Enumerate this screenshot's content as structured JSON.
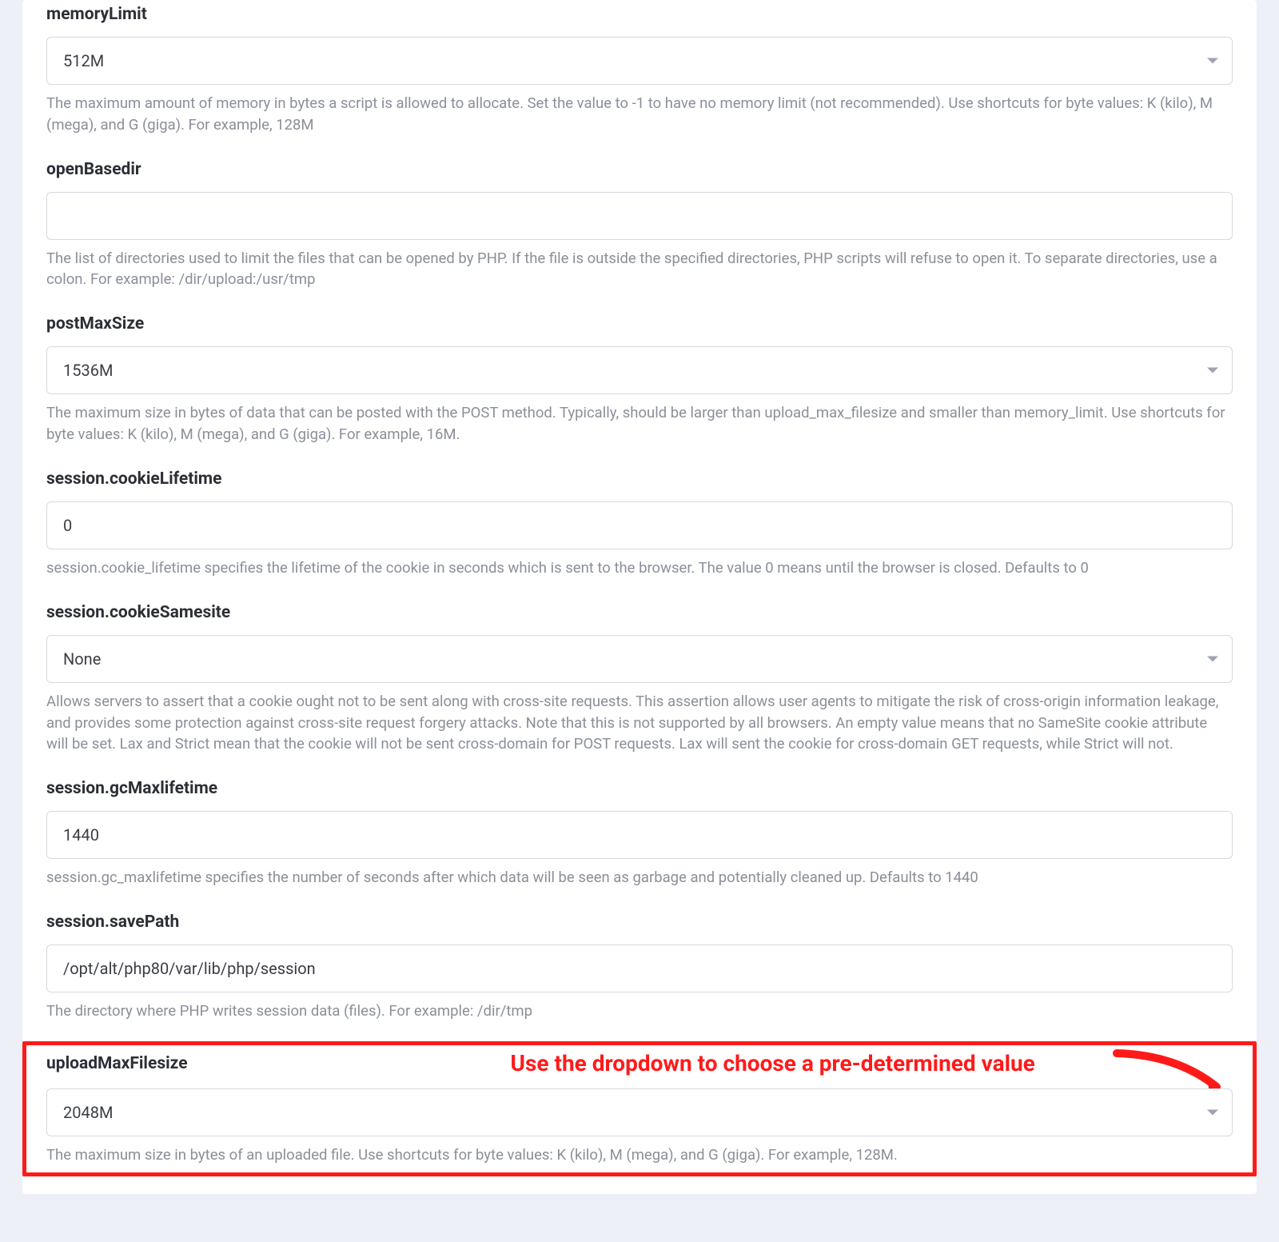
{
  "fields": {
    "memoryLimit": {
      "label": "memoryLimit",
      "value": "512M",
      "help": "The maximum amount of memory in bytes a script is allowed to allocate. Set the value to -1 to have no memory limit (not recommended). Use shortcuts for byte values: K (kilo), M (mega), and G (giga). For example, 128M"
    },
    "openBasedir": {
      "label": "openBasedir",
      "value": "",
      "help": "The list of directories used to limit the files that can be opened by PHP. If the file is outside the specified directories, PHP scripts will refuse to open it. To separate directories, use a colon. For example: /dir/upload:/usr/tmp"
    },
    "postMaxSize": {
      "label": "postMaxSize",
      "value": "1536M",
      "help": "The maximum size in bytes of data that can be posted with the POST method. Typically, should be larger than upload_max_filesize and smaller than memory_limit. Use shortcuts for byte values: K (kilo), M (mega), and G (giga). For example, 16M."
    },
    "sessionCookieLifetime": {
      "label": "session.cookieLifetime",
      "value": "0",
      "help": "session.cookie_lifetime specifies the lifetime of the cookie in seconds which is sent to the browser. The value 0 means until the browser is closed. Defaults to 0"
    },
    "sessionCookieSamesite": {
      "label": "session.cookieSamesite",
      "value": "None",
      "help": "Allows servers to assert that a cookie ought not to be sent along with cross-site requests. This assertion allows user agents to mitigate the risk of cross-origin information leakage, and provides some protection against cross-site request forgery attacks. Note that this is not supported by all browsers. An empty value means that no SameSite cookie attribute will be set. Lax and Strict mean that the cookie will not be sent cross-domain for POST requests. Lax will sent the cookie for cross-domain GET requests, while Strict will not."
    },
    "sessionGcMaxlifetime": {
      "label": "session.gcMaxlifetime",
      "value": "1440",
      "help": "session.gc_maxlifetime specifies the number of seconds after which data will be seen as garbage and potentially cleaned up. Defaults to 1440"
    },
    "sessionSavePath": {
      "label": "session.savePath",
      "value": "/opt/alt/php80/var/lib/php/session",
      "help": "The directory where PHP writes session data (files). For example: /dir/tmp"
    },
    "uploadMaxFilesize": {
      "label": "uploadMaxFilesize",
      "value": "2048M",
      "help": "The maximum size in bytes of an uploaded file. Use shortcuts for byte values: K (kilo), M (mega), and G (giga). For example, 128M."
    }
  },
  "annotation": {
    "text": "Use the dropdown to choose a pre-determined value"
  }
}
